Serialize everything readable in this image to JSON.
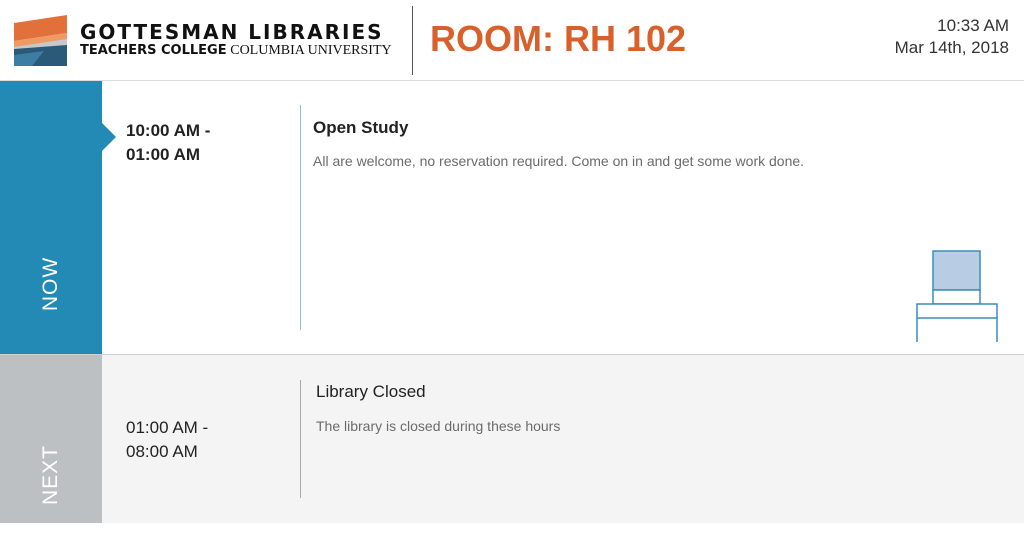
{
  "header": {
    "logo_name": "GOTTESMAN LIBRARIES",
    "logo_sub_bold": "TEACHERS COLLEGE",
    "logo_sub_serif": "COLUMBIA UNIVERSITY",
    "room_title": "ROOM: RH 102",
    "time": "10:33 AM",
    "date": "Mar 14th, 2018"
  },
  "now": {
    "label": "NOW",
    "time_start": "10:00 AM -",
    "time_end": "01:00 AM",
    "title": "Open Study",
    "description": "All are welcome, no reservation required. Come on in and get some work done."
  },
  "next": {
    "label": "NEXT",
    "time_start": "01:00 AM -",
    "time_end": "08:00 AM",
    "title": "Library Closed",
    "description": "The library is closed during these hours"
  },
  "icons": {
    "logo": "gottesman-libraries-logo-icon",
    "desk": "study-desk-icon"
  },
  "colors": {
    "accent_blue": "#238ab5",
    "room_orange": "#d9602b",
    "next_gray": "#bdc0c3"
  }
}
